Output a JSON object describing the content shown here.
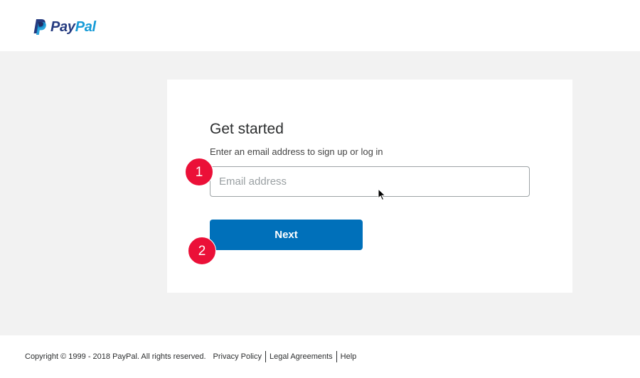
{
  "header": {
    "logo": {
      "word_part1": "Pay",
      "word_part2": "Pal",
      "icon": "paypal-p-icon"
    }
  },
  "form": {
    "heading": "Get started",
    "subtext": "Enter an email address to sign up or log in",
    "email": {
      "placeholder": "Email address",
      "value": ""
    },
    "next_label": "Next"
  },
  "annotations": {
    "badge1": "1",
    "badge2": "2"
  },
  "footer": {
    "copyright": "Copyright © 1999 - 2018 PayPal. All rights reserved.",
    "links": [
      "Privacy Policy",
      "Legal Agreements",
      "Help"
    ]
  },
  "colors": {
    "brand_dark": "#253b80",
    "brand_light": "#179bd7",
    "button": "#0070ba",
    "badge": "#eb1038",
    "background": "#f2f2f2"
  }
}
